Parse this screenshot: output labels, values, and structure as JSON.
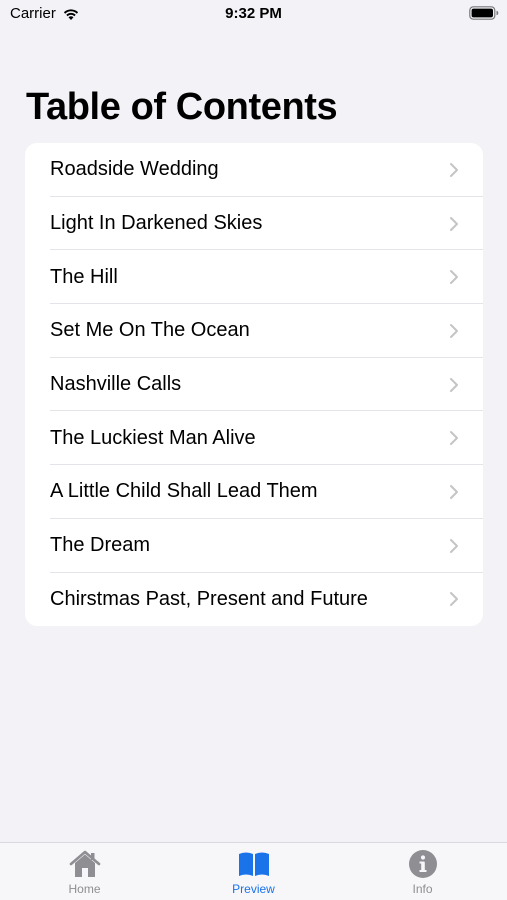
{
  "status_bar": {
    "carrier": "Carrier",
    "time": "9:32 PM"
  },
  "page": {
    "title": "Table of Contents"
  },
  "toc": {
    "items": [
      {
        "label": "Roadside Wedding"
      },
      {
        "label": "Light In Darkened Skies"
      },
      {
        "label": "The Hill"
      },
      {
        "label": "Set Me On The Ocean"
      },
      {
        "label": "Nashville Calls"
      },
      {
        "label": "The Luckiest Man Alive"
      },
      {
        "label": "A Little Child Shall Lead Them"
      },
      {
        "label": "The Dream"
      },
      {
        "label": "Chirstmas Past, Present and Future"
      }
    ]
  },
  "tab_bar": {
    "tabs": [
      {
        "label": "Home",
        "icon": "house-icon",
        "active": false
      },
      {
        "label": "Preview",
        "icon": "book-icon",
        "active": true
      },
      {
        "label": "Info",
        "icon": "info-icon",
        "active": false
      }
    ]
  },
  "colors": {
    "accent": "#1a73e8",
    "inactive": "#8e8e93",
    "background": "#f2f2f7"
  }
}
